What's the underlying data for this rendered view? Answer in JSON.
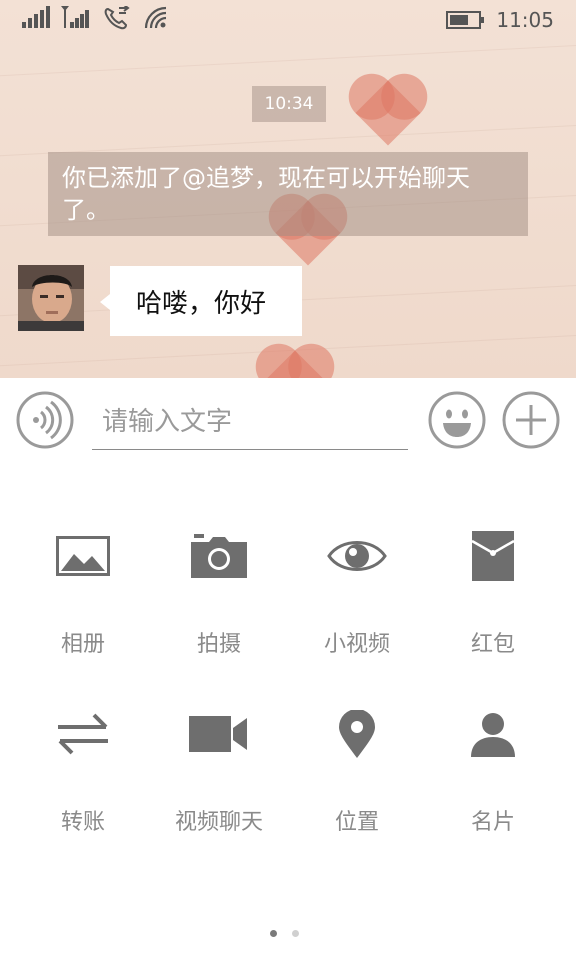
{
  "status_bar": {
    "time": "11:05"
  },
  "chat": {
    "timestamp": "10:34",
    "system_message": "你已添加了@追梦，现在可以开始聊天了。",
    "messages": [
      {
        "sender": "contact",
        "text": "哈喽，你好"
      }
    ]
  },
  "input": {
    "placeholder": "请输入文字"
  },
  "panel": {
    "items": [
      {
        "label": "相册",
        "icon": "album-icon"
      },
      {
        "label": "拍摄",
        "icon": "camera-icon"
      },
      {
        "label": "小视频",
        "icon": "eye-icon"
      },
      {
        "label": "红包",
        "icon": "red-packet-icon"
      },
      {
        "label": "转账",
        "icon": "transfer-icon"
      },
      {
        "label": "视频聊天",
        "icon": "video-camera-icon"
      },
      {
        "label": "位置",
        "icon": "location-pin-icon"
      },
      {
        "label": "名片",
        "icon": "contact-card-icon"
      }
    ],
    "page_count": 2,
    "current_page": 1
  },
  "colors": {
    "chat_bg": "#f1ddcf",
    "icon_gray": "#6e6e6e",
    "label_gray": "#8a8a8a"
  }
}
